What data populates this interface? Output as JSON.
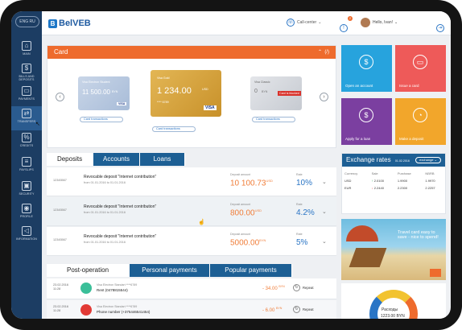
{
  "app": {
    "brand": "BelVEB",
    "logo_mark": "B"
  },
  "sidebar": {
    "lang": "ENG  RU",
    "items": [
      {
        "label": "MAIN",
        "icon": "home-icon",
        "glyph": "⌂"
      },
      {
        "label": "BILLS AND DEPOSITS",
        "icon": "coin-icon",
        "glyph": "$"
      },
      {
        "label": "PAYMENTS",
        "icon": "wallet-icon",
        "glyph": "▭"
      },
      {
        "label": "TRANSFERS",
        "icon": "transfer-icon",
        "glyph": "⇄"
      },
      {
        "label": "CREDITS",
        "icon": "credit-icon",
        "glyph": "%"
      },
      {
        "label": "PAYSLIPS",
        "icon": "document-icon",
        "glyph": "≡"
      },
      {
        "label": "SECURITY",
        "icon": "lock-icon",
        "glyph": "▣"
      },
      {
        "label": "PROFILE",
        "icon": "user-icon",
        "glyph": "◉"
      },
      {
        "label": "INFORMATION",
        "icon": "megaphone-icon",
        "glyph": "◁"
      }
    ]
  },
  "header": {
    "call_center": "Call-center",
    "notif_count": "2",
    "user_greeting": "Hello, Ivan!"
  },
  "card_section": {
    "title": "Card",
    "cards": [
      {
        "top": "Visa Electron Student",
        "amount": "11 500.00",
        "cur": "BYN",
        "brand": "VISA",
        "btn": "Card transactions"
      },
      {
        "top": "Visa Gold",
        "amount": "1 234.00",
        "cur": "USD",
        "number": "**** 6789",
        "brand": "VISA",
        "btn": "Card transactions"
      },
      {
        "top": "Visa Classic",
        "amount": "0",
        "cur": "BYN",
        "status": "Card is blocked",
        "btn": "Card transactions"
      }
    ]
  },
  "tiles": [
    {
      "label": "Open an account",
      "icon": "dollar-icon",
      "glyph": "$",
      "color": "#27a3dd"
    },
    {
      "label": "Issue a card",
      "icon": "card-icon",
      "glyph": "▭",
      "color": "#ee5a59"
    },
    {
      "label": "Apply for a loan",
      "icon": "moneybag-icon",
      "glyph": "$",
      "color": "#7b3fa0"
    },
    {
      "label": "Make a deposit",
      "icon": "piggybank-icon",
      "glyph": "◔",
      "color": "#f2a62b"
    }
  ],
  "deposits_tabs": [
    "Deposits",
    "Accounts",
    "Loans"
  ],
  "deposits": [
    {
      "id": "12345567",
      "name": "Revocable deposit \"Internet contribution\"",
      "dates": "from 01.01.2016 to 01.01.2016",
      "amount_label": "Deposit amount",
      "amount": "10 100.73",
      "cur": "USD",
      "rate_label": "Rate",
      "rate": "10%"
    },
    {
      "id": "12345567",
      "name": "Revocable deposit \"Internet contribution\"",
      "dates": "from 01.01.2016 to 01.01.2016",
      "amount_label": "Deposit amount",
      "amount": "800.00",
      "cur": "USD",
      "rate_label": "Rate",
      "rate": "4.2%"
    },
    {
      "id": "12345567",
      "name": "Revocable deposit \"Internet contribution\"",
      "dates": "from 01.01.2016 to 01.01.2016",
      "amount_label": "Deposit amount",
      "amount": "5000.00",
      "cur": "BYN",
      "rate_label": "Rate",
      "rate": "5%"
    }
  ],
  "exchange": {
    "title": "Exchange rates",
    "date": "01.02.2016",
    "select": "exchange",
    "headers": [
      "Currency",
      "Sale",
      "Purchase",
      "NBRB"
    ],
    "rows": [
      {
        "cur": "USD",
        "sale": "2.0100",
        "purchase": "1.9900",
        "nbrb": "1.9970"
      },
      {
        "cur": "EUR",
        "sale": "2.2440",
        "purchase": "2.2300",
        "nbrb": "2.2257"
      }
    ]
  },
  "promo": {
    "text": "Travel card easy to save - nice to spend!"
  },
  "donut": {
    "label": "Расходы",
    "value": "1223.00 BYN"
  },
  "post_tabs": [
    "Post-operation",
    "Personal payments",
    "Popular payments"
  ],
  "operations": [
    {
      "date": "23.02.2016",
      "time": "11:28",
      "card": "Visa Electron Standart ****6789",
      "name": "Rent (0478815544)",
      "amount": "- 34.00",
      "cur": "BYN",
      "action": "Repeat",
      "color": "#3bbf99"
    },
    {
      "date": "23.02.2016",
      "time": "11:28",
      "card": "Visa Electron Standart ****6789",
      "name": "Phone number (+375446541454)",
      "amount": "- 6.00",
      "cur": "BYN",
      "action": "Repeat",
      "color": "#e23a35"
    }
  ]
}
